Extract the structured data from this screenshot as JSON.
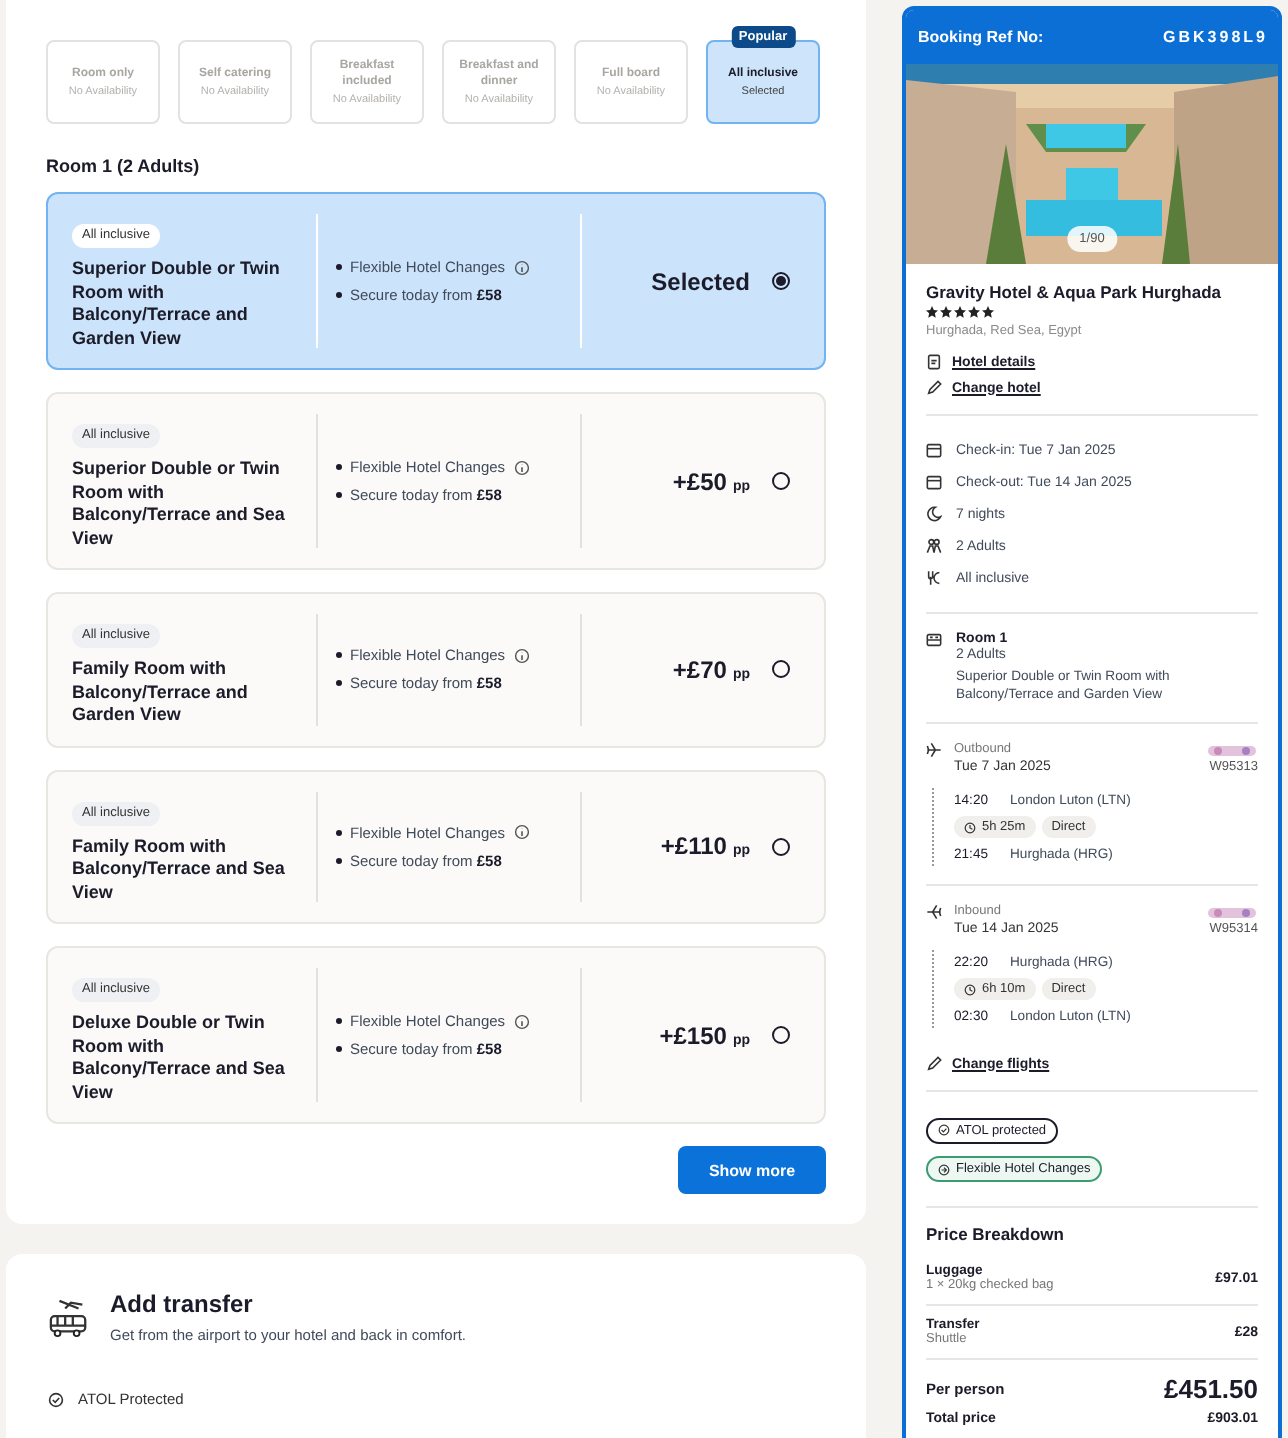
{
  "meal_options": [
    {
      "label": "Room only",
      "availability": "No Availability",
      "selected": false
    },
    {
      "label": "Self catering",
      "availability": "No Availability",
      "selected": false
    },
    {
      "label": "Breakfast included",
      "availability": "No Availability",
      "selected": false
    },
    {
      "label": "Breakfast and dinner",
      "availability": "No Availability",
      "selected": false
    },
    {
      "label": "Full board",
      "availability": "No Availability",
      "selected": false
    },
    {
      "label": "All inclusive",
      "availability": "Selected",
      "selected": true,
      "badge": "Popular"
    }
  ],
  "rooms_heading": "Room 1 (2 Adults)",
  "rooms": [
    {
      "board": "All inclusive",
      "name": "Superior Double or Twin Room with Balcony/Terrace and Garden View",
      "features": [
        {
          "text": "Flexible Hotel Changes",
          "info": true
        },
        {
          "text": "Secure today from **£58**",
          "info": false
        }
      ],
      "price": "Selected",
      "selected": true
    },
    {
      "board": "All inclusive",
      "name": "Superior Double or Twin Room with Balcony/Terrace and Sea View",
      "features": [
        {
          "text": "Flexible Hotel Changes",
          "info": true
        },
        {
          "text": "Secure today from **£58**",
          "info": false
        }
      ],
      "price": "+£50",
      "unit": "pp",
      "selected": false
    },
    {
      "board": "All inclusive",
      "name": "Family Room with Balcony/Terrace and Garden View",
      "features": [
        {
          "text": "Flexible Hotel Changes",
          "info": true
        },
        {
          "text": "Secure today from **£58**",
          "info": false
        }
      ],
      "price": "+£70",
      "unit": "pp",
      "selected": false
    },
    {
      "board": "All inclusive",
      "name": "Family Room with Balcony/Terrace and Sea View",
      "features": [
        {
          "text": "Flexible Hotel Changes",
          "info": true
        },
        {
          "text": "Secure today from **£58**",
          "info": false
        }
      ],
      "price": "+£110",
      "unit": "pp",
      "selected": false
    },
    {
      "board": "All inclusive",
      "name": "Deluxe Double or Twin Room with Balcony/Terrace and Sea View",
      "features": [
        {
          "text": "Flexible Hotel Changes",
          "info": true
        },
        {
          "text": "Secure today from **£58**",
          "info": false
        }
      ],
      "price": "+£150",
      "unit": "pp",
      "selected": false
    }
  ],
  "show_more": "Show more",
  "transfer": {
    "title": "Add transfer",
    "description": "Get from the airport to your hotel and back in comfort.",
    "features": [
      "ATOL Protected"
    ]
  },
  "booking": {
    "ref_label": "Booking Ref No:",
    "ref": "GBK398L9",
    "photo_counter": "1/90",
    "hotel_name": "Gravity Hotel & Aqua Park Hurghada",
    "stars": 5,
    "location": "Hurghada, Red Sea, Egypt",
    "links": [
      {
        "kind": "details",
        "text": "Hotel details"
      },
      {
        "kind": "edit",
        "text": "Change hotel"
      }
    ],
    "details": [
      {
        "kind": "calendar",
        "text": "Check-in: Tue 7 Jan 2025"
      },
      {
        "kind": "calendar",
        "text": "Check-out: Tue 14 Jan 2025"
      },
      {
        "kind": "night",
        "text": "7 nights"
      },
      {
        "kind": "people",
        "text": "2 Adults"
      },
      {
        "kind": "meal",
        "text": "All inclusive"
      }
    ],
    "room": {
      "title": "Room 1",
      "guests": "2 Adults",
      "description": "Superior Double or Twin Room with Balcony/Terrace and Garden View"
    },
    "flights": [
      {
        "kind": "outbound",
        "direction": "Outbound",
        "date": "Tue 7 Jan 2025",
        "flight_number": "W95313",
        "depart_time": "14:20",
        "depart_airport": "London Luton (LTN)",
        "duration": "5h 25m",
        "stops": "Direct",
        "arrive_time": "21:45",
        "arrive_airport": "Hurghada (HRG)"
      },
      {
        "kind": "inbound",
        "direction": "Inbound",
        "date": "Tue 14 Jan 2025",
        "flight_number": "W95314",
        "depart_time": "22:20",
        "depart_airport": "Hurghada (HRG)",
        "duration": "6h 10m",
        "stops": "Direct",
        "arrive_time": "02:30",
        "arrive_airport": "London Luton (LTN)"
      }
    ],
    "change_flights": "Change flights",
    "tags": [
      {
        "kind": "atol",
        "text": "ATOL protected"
      },
      {
        "kind": "flexible",
        "text": "Flexible Hotel Changes"
      }
    ],
    "price_breakdown": {
      "title": "Price Breakdown",
      "items": [
        {
          "label": "Luggage",
          "detail": "1 × 20kg checked bag",
          "amount": "£97.01"
        },
        {
          "label": "Transfer",
          "detail": "Shuttle",
          "amount": "£28"
        }
      ],
      "per_person_label": "Per person",
      "per_person": "£451.50",
      "total_label": "Total price",
      "total": "£903.01"
    }
  }
}
